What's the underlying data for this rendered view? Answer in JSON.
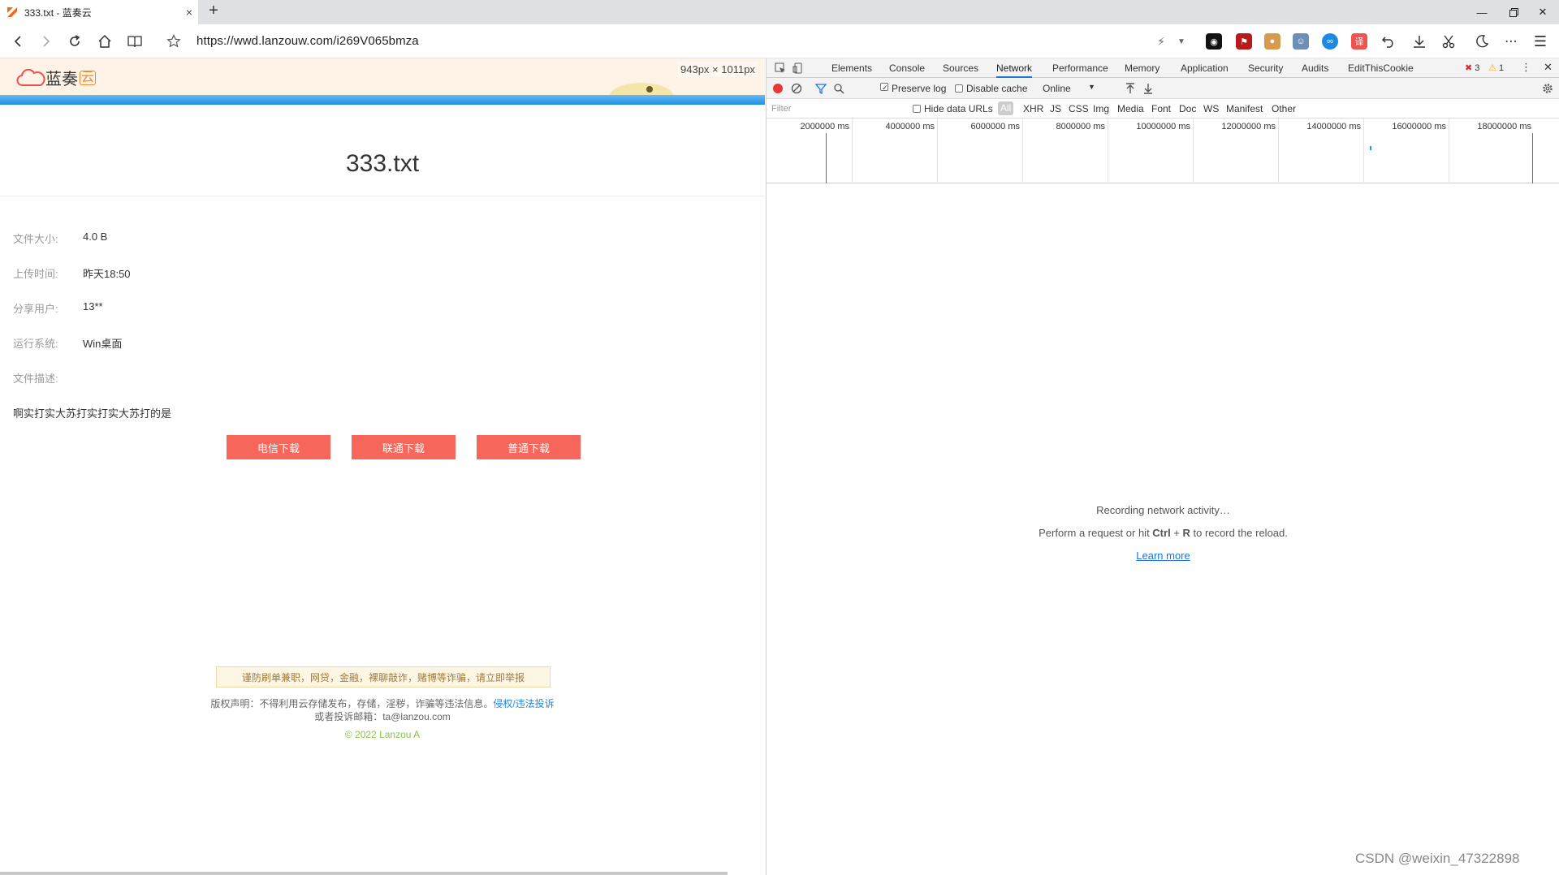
{
  "browser": {
    "tab_title": "333.txt - 蓝奏云",
    "tab_close": "×",
    "new_tab": "+",
    "url": "https://wwd.lanzouw.com/i269V065bmza"
  },
  "page": {
    "logo_text": "蓝奏",
    "logo_badge": "云",
    "dimension_tip": "943px × 1011px",
    "file_title": "333.txt",
    "info": [
      {
        "key": "文件大小:",
        "value": "4.0 B"
      },
      {
        "key": "上传时间:",
        "value": "昨天18:50"
      },
      {
        "key": "分享用户:",
        "value": "13**"
      },
      {
        "key": "运行系统:",
        "value": "Win桌面"
      },
      {
        "key": "文件描述:",
        "value": ""
      }
    ],
    "description": "啊实打实大苏打实打实大苏打的是",
    "buttons": {
      "telecom": "电信下载",
      "unicom": "联通下载",
      "normal": "普通下载"
    },
    "warning": "谨防刷单兼职，网贷，金融，裸聊敲诈，赌博等诈骗，请立即举报",
    "copyright": "版权声明：不得利用云存储发布，存储，淫秽，诈骗等违法信息。",
    "report_link": "侵权/违法投诉",
    "email_line": "或者投诉邮箱：ta@lanzou.com",
    "footer": "© 2022 Lanzou A"
  },
  "devtools": {
    "tabs": [
      "Elements",
      "Console",
      "Sources",
      "Network",
      "Performance",
      "Memory",
      "Application",
      "Security",
      "Audits",
      "EditThisCookie"
    ],
    "active_tab": "Network",
    "errors": "3",
    "warnings": "1",
    "preserve_log": "Preserve log",
    "disable_cache": "Disable cache",
    "throttle": "Online",
    "filter_placeholder": "Filter",
    "hide_data_urls": "Hide data URLs",
    "filter_types": [
      "All",
      "XHR",
      "JS",
      "CSS",
      "Img",
      "Media",
      "Font",
      "Doc",
      "WS",
      "Manifest",
      "Other"
    ],
    "timeline_ticks": [
      "2000000 ms",
      "4000000 ms",
      "6000000 ms",
      "8000000 ms",
      "10000000 ms",
      "12000000 ms",
      "14000000 ms",
      "16000000 ms",
      "18000000 ms"
    ],
    "empty_title": "Recording network activity…",
    "empty_hint_pre": "Perform a request or hit ",
    "empty_hint_key1": "Ctrl",
    "empty_hint_plus": " + ",
    "empty_hint_key2": "R",
    "empty_hint_post": " to record the reload.",
    "learn_more": "Learn more"
  },
  "watermark": "CSDN @weixin_47322898",
  "colors": {
    "download_button": "#f7665b",
    "header_bg": "#fff3e8",
    "accent_blue": "#1a73e8"
  }
}
